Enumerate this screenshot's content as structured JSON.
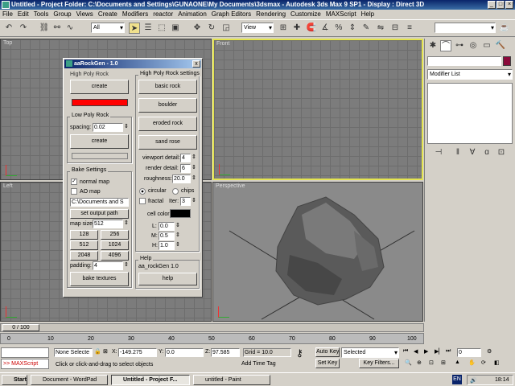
{
  "window": {
    "title": "Untitled    - Project Folder: C:\\Documents and Settings\\GUNAONE\\My Documents\\3dsmax    - Autodesk 3ds Max 9 SP1    - Display : Direct 3D",
    "minimize": "_",
    "maximize": "□",
    "close": "×"
  },
  "menu": [
    "File",
    "Edit",
    "Tools",
    "Group",
    "Views",
    "Create",
    "Modifiers",
    "reactor",
    "Animation",
    "Graph Editors",
    "Rendering",
    "Customize",
    "MAXScript",
    "Help"
  ],
  "toolbar": {
    "selection_filter": "All",
    "ref_coord": "View"
  },
  "viewports": {
    "top": "Top",
    "front": "Front",
    "left": "Left",
    "perspective": "Perspective"
  },
  "command_panel": {
    "modifier_list": "Modifier List"
  },
  "dialog": {
    "title": "aaRockGen - 1.0",
    "close": "x",
    "high_poly_rock": "High Poly Rock",
    "create_label": "create",
    "low_poly_rock": "Low Poly Rock",
    "spacing_label": "spacing:",
    "spacing_value": "0.02",
    "create2_label": "create",
    "bake_settings": "Bake Settings",
    "normal_map": "normal map",
    "ao_map": "AO map",
    "path_value": "C:\\Documents and S",
    "set_output_path": "set output path",
    "map_size_label": "map size:",
    "map_size_value": "512",
    "sizes": [
      "128",
      "256",
      "512",
      "1024",
      "2048",
      "4096"
    ],
    "padding_label": "padding:",
    "padding_value": "4",
    "bake_textures": "bake textures",
    "high_poly_settings": "High Poly Rock settings",
    "basic_rock": "basic rock",
    "boulder": "boulder",
    "eroded_rock": "eroded rock",
    "sand_rose": "sand rose",
    "viewport_detail_label": "viewport detail:",
    "viewport_detail_value": "4",
    "render_detail_label": "render detail:",
    "render_detail_value": "6",
    "roughness_label": "roughness:",
    "roughness_value": "20.0",
    "circular": "circular",
    "chips": "chips",
    "fractal": "fractal",
    "iter_label": "Iter:",
    "iter_value": "3",
    "cell_color_label": "cell color:",
    "cell_color": "#000000",
    "l_label": "L:",
    "l_value": "0.0",
    "m_label": "M:",
    "m_value": "0.5",
    "h_label": "H:",
    "h_value": "1.0",
    "help_group": "Help",
    "help_text": "aa_rockGen 1.0",
    "help_button": "help"
  },
  "timeline": {
    "frame": "0 / 100",
    "ticks": [
      "0",
      "10",
      "20",
      "30",
      "40",
      "50",
      "60",
      "70",
      "80",
      "90",
      "100"
    ]
  },
  "status": {
    "selection": "None Selecte",
    "x_label": "X:",
    "x_value": "-149.275",
    "y_label": "Y:",
    "y_value": "0.0",
    "z_label": "Z:",
    "z_value": "97.585",
    "grid": "Grid = 10.0",
    "auto_key": "Auto Key",
    "selected": "Selected",
    "set_key": "Set Key",
    "key_filters": "Key Filters...",
    "frame_value": "0",
    "prompt": "Click or click-and-drag to select objects",
    "add_time_tag": "Add Time Tag",
    "maxscript": ">> MAXScript"
  },
  "taskbar": {
    "start": "Start",
    "tasks": [
      "Document - WordPad",
      "Untitled    - Project F...",
      "untitled - Paint"
    ],
    "lang": "EN",
    "time": "18:14"
  },
  "colors": {
    "accent_red": "#ff0000",
    "front_border": "#e4e450"
  }
}
